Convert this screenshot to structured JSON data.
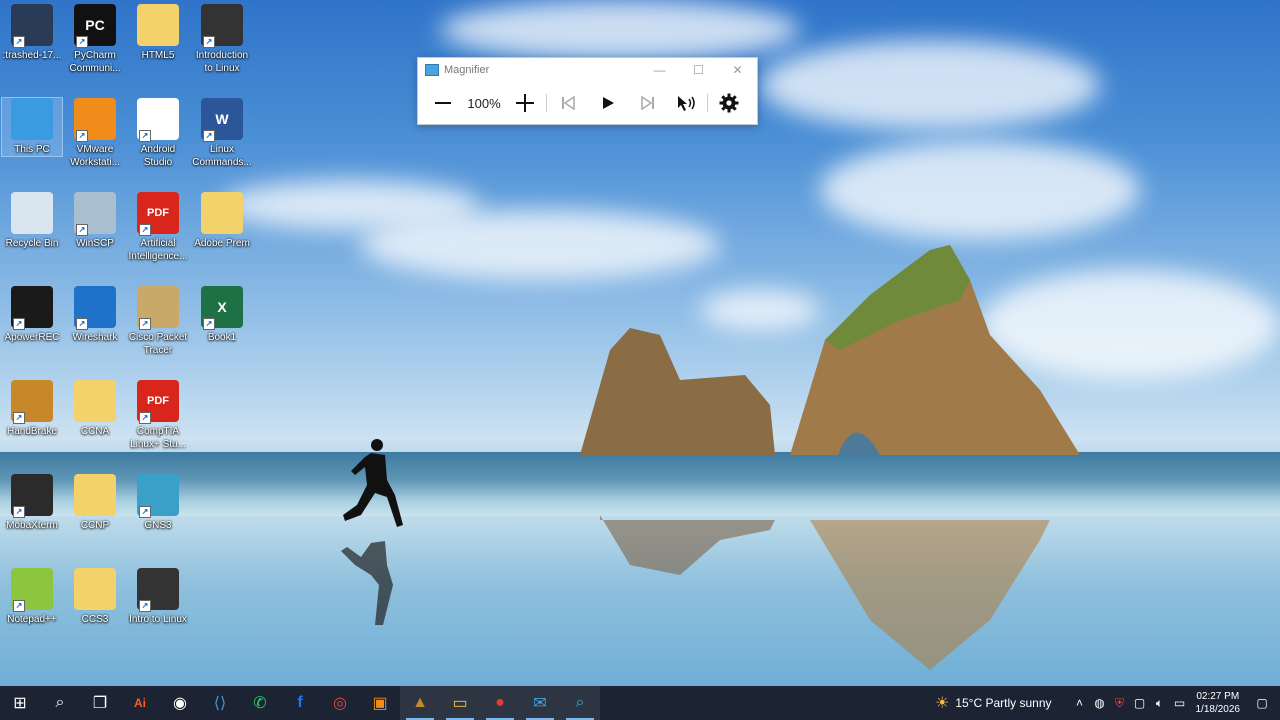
{
  "desktop_icons": [
    {
      "label": ":trashed-17...",
      "icon": "video-thumbnail-icon",
      "color": "#2a3b55"
    },
    {
      "label": "PyCharm Communi...",
      "icon": "pycharm-icon",
      "color": "#111111"
    },
    {
      "label": "HTML5",
      "icon": "folder-icon",
      "color": "#f3d26b"
    },
    {
      "label": "Introduction to Linux",
      "icon": "presentation-icon",
      "color": "#333333"
    },
    {
      "label": "This PC",
      "icon": "this-pc-icon",
      "color": "#3b9be0"
    },
    {
      "label": "VMware Workstati...",
      "icon": "vmware-icon",
      "color": "#f08c1a"
    },
    {
      "label": "Android Studio",
      "icon": "android-studio-icon",
      "color": "#ffffff"
    },
    {
      "label": "Linux Commands...",
      "icon": "word-document-icon",
      "color": "#2b579a"
    },
    {
      "label": "Recycle Bin",
      "icon": "recycle-bin-icon",
      "color": "#d9e6f0"
    },
    {
      "label": "WinSCP",
      "icon": "winscp-icon",
      "color": "#a8bfd0"
    },
    {
      "label": "Artificial Intelligence...",
      "icon": "pdf-icon",
      "color": "#d9261c"
    },
    {
      "label": "Adobe Prem",
      "icon": "folder-icon",
      "color": "#f3d26b"
    },
    {
      "label": "ApowerREC",
      "icon": "apowerrec-icon",
      "color": "#1a1a1a"
    },
    {
      "label": "Wireshark",
      "icon": "wireshark-icon",
      "color": "#1e72c8"
    },
    {
      "label": "Cisco Packet Tracer",
      "icon": "packet-tracer-icon",
      "color": "#c8a96a"
    },
    {
      "label": "Book1",
      "icon": "excel-icon",
      "color": "#1e7145"
    },
    {
      "label": "HandBrake",
      "icon": "handbrake-icon",
      "color": "#c8882a"
    },
    {
      "label": "CCNA",
      "icon": "folder-icon",
      "color": "#f3d26b"
    },
    {
      "label": "CompTIA Linux+ Stu...",
      "icon": "pdf-icon",
      "color": "#d9261c"
    },
    {
      "label": "MobaXterm",
      "icon": "mobaxterm-icon",
      "color": "#2b2b2b"
    },
    {
      "label": "CCNP",
      "icon": "folder-icon",
      "color": "#f3d26b"
    },
    {
      "label": "GNS3",
      "icon": "gns3-icon",
      "color": "#3aa0c8"
    },
    {
      "label": "Notepad++",
      "icon": "notepad-plus-plus-icon",
      "color": "#8cc63f"
    },
    {
      "label": "CCS3",
      "icon": "folder-icon",
      "color": "#f3d26b"
    },
    {
      "label": "Intro to Linux",
      "icon": "presentation-icon",
      "color": "#333333"
    }
  ],
  "magnifier": {
    "title": "Magnifier",
    "zoom": "100%",
    "minimize": "—",
    "maximize": "☐",
    "close": "✕"
  },
  "taskbar": {
    "apps": [
      {
        "name": "start",
        "glyph": "⊞"
      },
      {
        "name": "search",
        "glyph": "⌕"
      },
      {
        "name": "task-view",
        "glyph": "❐"
      },
      {
        "name": "adobe-illustrator",
        "glyph": "Ai"
      },
      {
        "name": "app-store",
        "glyph": "◉"
      },
      {
        "name": "vscode",
        "glyph": "⟨⟩"
      },
      {
        "name": "whatsapp",
        "glyph": "✆"
      },
      {
        "name": "facebook",
        "glyph": "f"
      },
      {
        "name": "chrome",
        "glyph": "◎"
      },
      {
        "name": "vmware",
        "glyph": "▣"
      },
      {
        "name": "handbrake",
        "glyph": "▲"
      },
      {
        "name": "file-explorer",
        "glyph": "▭"
      },
      {
        "name": "apowerrec",
        "glyph": "●"
      },
      {
        "name": "mail",
        "glyph": "✉"
      },
      {
        "name": "magnifier",
        "glyph": "⌕"
      }
    ],
    "weather": "15°C  Partly sunny",
    "time": "02:27 PM",
    "date": "1/18/2026"
  }
}
